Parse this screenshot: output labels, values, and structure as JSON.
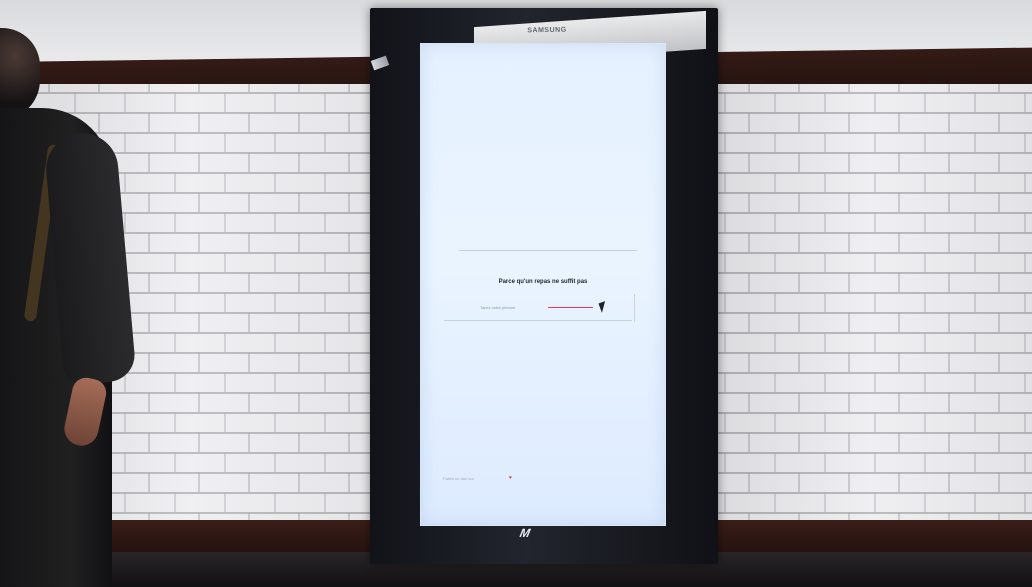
{
  "scene": {
    "kiosk": {
      "brand": "SAMSUNG",
      "logo": "M",
      "screen": {
        "message": "Parce qu'un repas ne suffit pas",
        "input_placeholder": "Tapez votre prénom",
        "footer_text": "Faites un don sur"
      }
    }
  }
}
